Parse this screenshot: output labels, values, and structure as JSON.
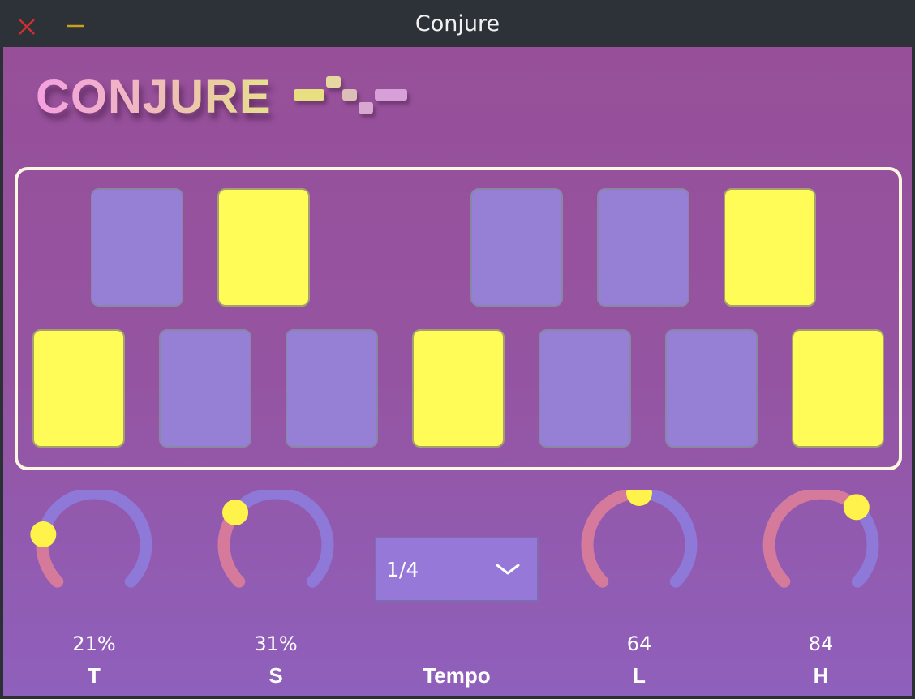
{
  "window": {
    "title": "Conjure",
    "close_color": "#d02f2f",
    "minimize_color": "#c9a020"
  },
  "logo": {
    "text": "CONJURE"
  },
  "pads": {
    "row1": [
      "off",
      "on",
      "empty",
      "off",
      "off",
      "on"
    ],
    "row2": [
      "on",
      "off",
      "off",
      "on",
      "off",
      "off",
      "on"
    ],
    "colors": {
      "off": "#9580d6",
      "on": "#fffc58"
    }
  },
  "knobs": [
    {
      "id": "t",
      "value_text": "21%",
      "label": "T",
      "fraction": 0.21
    },
    {
      "id": "s",
      "value_text": "31%",
      "label": "S",
      "fraction": 0.31
    },
    {
      "id": "l",
      "value_text": "64",
      "label": "L",
      "fraction": 0.5
    },
    {
      "id": "h",
      "value_text": "84",
      "label": "H",
      "fraction": 0.66
    }
  ],
  "tempo": {
    "label": "Tempo",
    "selected": "1/4"
  },
  "colors": {
    "knob_track": "#8e78d8",
    "knob_fill": "#d57a9a",
    "knob_handle": "#fff24a",
    "frame": "#fdf6e0"
  }
}
